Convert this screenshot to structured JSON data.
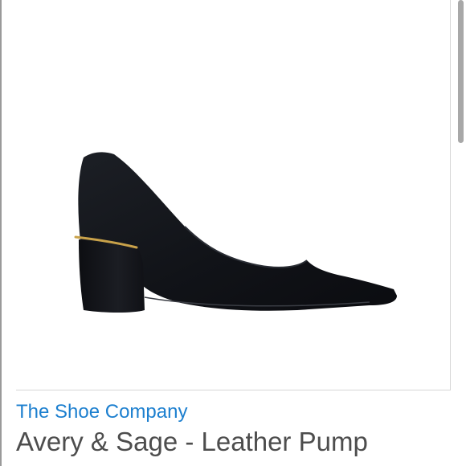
{
  "product": {
    "brand": "The Shoe Company",
    "title": "Avery & Sage - Leather Pump",
    "image_subject": "black-leather-block-heel-pump"
  },
  "colors": {
    "brand_link": "#1c7fcf",
    "title_text": "#4d4d4d",
    "shoe_leather": "#15171c",
    "heel_trim": "#c9a24a",
    "frame_border": "#d6d6d6"
  }
}
